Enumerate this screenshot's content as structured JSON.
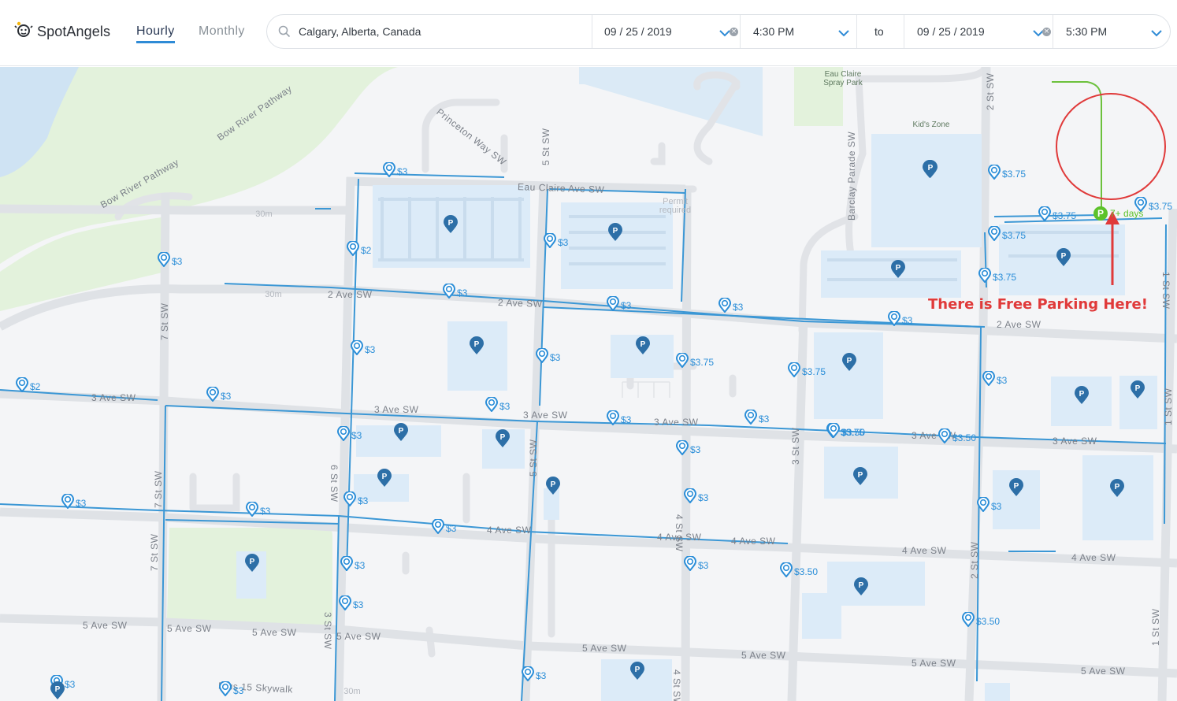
{
  "app": {
    "logo_text": "SpotAngels",
    "tabs": [
      {
        "label": "Hourly"
      },
      {
        "label": "Monthly"
      }
    ]
  },
  "search": {
    "location": "Calgary, Alberta, Canada",
    "start_date": "09 / 25 / 2019",
    "start_time": "4:30 PM",
    "to_label": "to",
    "end_date": "09 / 25 / 2019",
    "end_time": "5:30 PM"
  },
  "colors": {
    "accent": "#2f8bd6",
    "price": "#2b8ed8",
    "lot_pin": "#2d6fa7",
    "free_green": "#5cc22a",
    "annotation_red": "#e03a3a",
    "water": "#cfe3f3",
    "park": "#e3f2dc"
  },
  "map": {
    "street_labels": [
      "Princeton Way SW",
      "5 St SW",
      "Eau Claire Ave SW",
      "Bow River Pathway",
      "Bow River Pathway",
      "Barclay Parade SW",
      "2 St SW",
      "2 Ave SW",
      "2 Ave SW",
      "2 Ave SW",
      "7 St SW",
      "3 Ave SW",
      "3 Ave SW",
      "3 Ave SW",
      "3 Ave SW",
      "3 Ave SW",
      "3 Ave SW",
      "4 Ave SW",
      "4 Ave SW",
      "4 Ave SW",
      "4 Ave SW",
      "4 Ave SW",
      "5 Ave SW",
      "5 Ave SW",
      "5 Ave SW",
      "5 Ave SW",
      "5 Ave SW",
      "5 Ave SW",
      "5 Ave SW",
      "5 Ave SW",
      "3 St SW",
      "4 St SW",
      "4 St SW",
      "1 St SW",
      "1 St SW",
      "7 St SW",
      "7 St SW",
      "6 St SW",
      "5 St SW",
      "2 St SW",
      "1 St SW",
      "Plus 15 Skywalk",
      "3 St SW"
    ],
    "pois": [
      {
        "name": "Eau Claire Spray Park"
      },
      {
        "name": "Kid's Zone"
      },
      {
        "name": "Permit required"
      },
      {
        "name": "30m"
      },
      {
        "name": "30m"
      },
      {
        "name": "30m"
      }
    ],
    "price_pins": [
      "$3",
      "$3",
      "$2",
      "$3",
      "$3",
      "$3",
      "$3",
      "$2",
      "$3",
      "$3",
      "$3.75",
      "$3.75",
      "$3",
      "$3",
      "$3",
      "$3",
      "$3",
      "$3",
      "$3.75",
      "$3.50",
      "$3.50",
      "$3",
      "$3",
      "$3",
      "$3",
      "$3",
      "$3",
      "$3",
      "$3",
      "$3",
      "$3.75",
      "$3.75",
      "$3.75",
      "$3.75",
      "$3.75",
      "$3",
      "$3.50",
      "$3.50",
      "$3",
      "$3",
      "$3",
      "$3"
    ],
    "free_parking": {
      "label": "7+ days",
      "icon": "P"
    },
    "annotation": "There is Free Parking Here!"
  }
}
